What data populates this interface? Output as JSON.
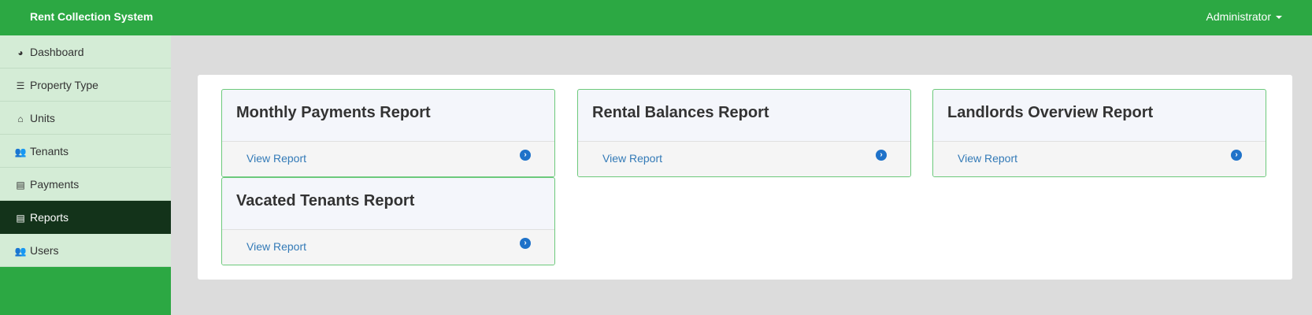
{
  "app": {
    "title": "Rent Collection System"
  },
  "user_menu": {
    "label": "Administrator"
  },
  "sidebar": {
    "items": [
      {
        "label": "Dashboard",
        "icon": "dashboard-icon",
        "glyph": "◕",
        "active": false
      },
      {
        "label": "Property Type",
        "icon": "list-icon",
        "glyph": "☰",
        "active": false
      },
      {
        "label": "Units",
        "icon": "home-icon",
        "glyph": "⌂",
        "active": false
      },
      {
        "label": "Tenants",
        "icon": "users-icon",
        "glyph": "👥",
        "active": false
      },
      {
        "label": "Payments",
        "icon": "receipt-icon",
        "glyph": "▤",
        "active": false
      },
      {
        "label": "Reports",
        "icon": "report-icon",
        "glyph": "▤",
        "active": true
      },
      {
        "label": "Users",
        "icon": "user-group-icon",
        "glyph": "👥",
        "active": false
      }
    ]
  },
  "reports": [
    {
      "title": "Monthly Payments Report",
      "link": "View Report"
    },
    {
      "title": "Rental Balances Report",
      "link": "View Report"
    },
    {
      "title": "Landlords Overview Report",
      "link": "View Report"
    },
    {
      "title": "Vacated Tenants Report",
      "link": "View Report"
    }
  ],
  "colors": {
    "primary": "#2ca843",
    "sidebar_item_bg": "#d4ecd6",
    "sidebar_active_bg": "#13331a",
    "card_border": "#6cc97b",
    "link": "#337ab7"
  }
}
